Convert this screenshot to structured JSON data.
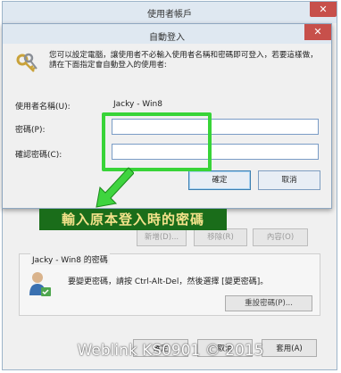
{
  "outer_window": {
    "title": "使用者帳戶",
    "close_glyph": "✕",
    "add_label": "新增(D)...",
    "remove_label": "移除(R)",
    "properties_label": "內容(O)",
    "password_group_title": "Jacky - Win8 的密碼",
    "password_hint": "要變更密碼，請按 Ctrl-Alt-Del，然後選擇 [變更密碼]。",
    "reset_password_label": "重設密碼(P)...",
    "ok_label": "確定",
    "cancel_label": "取消",
    "apply_label": "套用(A)"
  },
  "dialog": {
    "title": "自動登入",
    "close_glyph": "✕",
    "description": "您可以設定電腦，讓使用者不必輸入使用者名稱和密碼即可登入，若要這樣做，請在下面指定會自動登入的使用者:",
    "username_label": "使用者名稱(U):",
    "username_value": "Jacky - Win8",
    "password_label": "密碼(P):",
    "password_value": "",
    "confirm_label": "確認密碼(C):",
    "confirm_value": "",
    "ok_label": "確定",
    "cancel_label": "取消"
  },
  "annotation": {
    "banner_text": "輸入原本登入時的密碼",
    "highlight_color": "#38d438"
  },
  "watermark": "Weblink KS0901 © 2015",
  "icons": [
    "keys-icon",
    "user-icon",
    "close-icon",
    "arrow-icon"
  ]
}
